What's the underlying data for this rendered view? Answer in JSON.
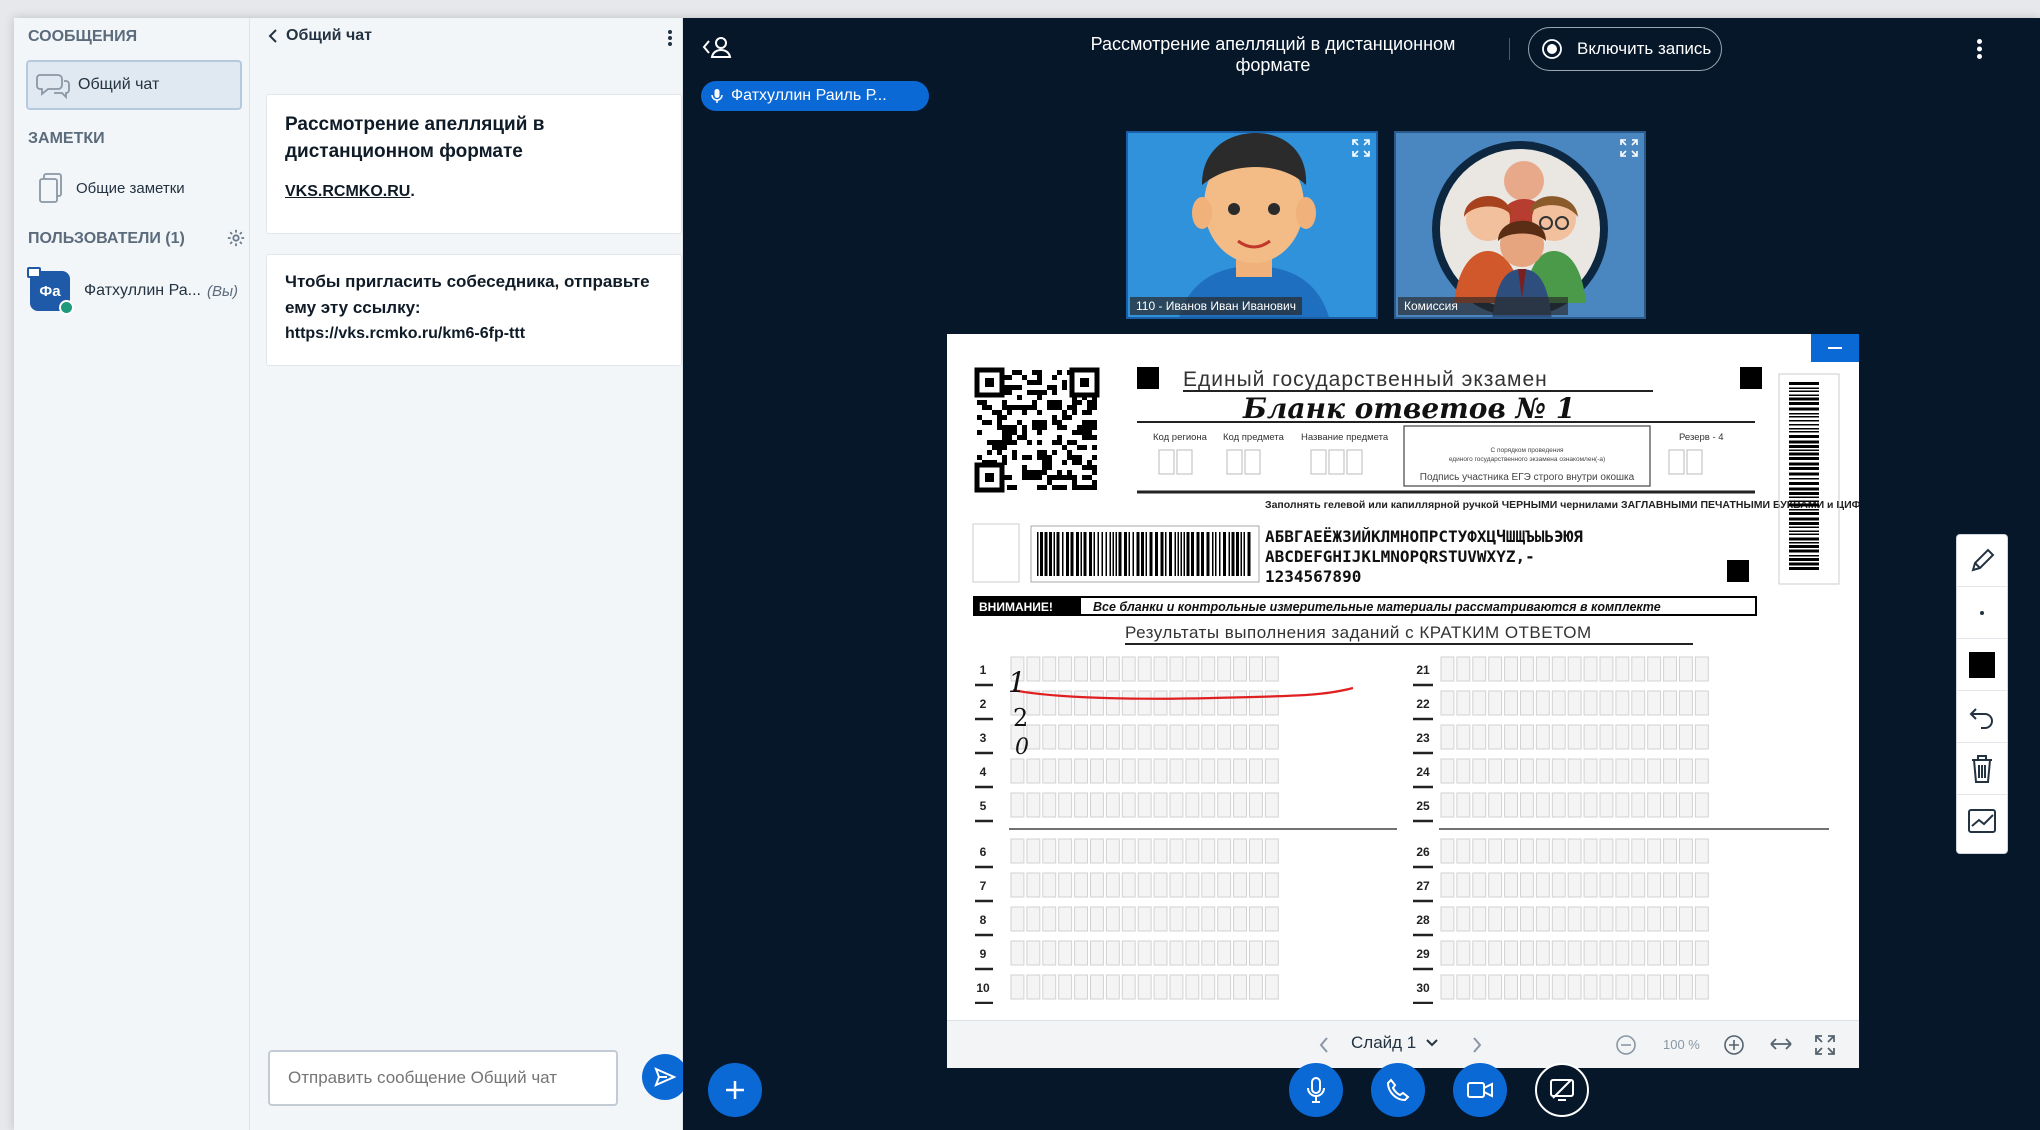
{
  "sidebar": {
    "messages_header": "СООБЩЕНИЯ",
    "public_chat_label": "Общий чат",
    "notes_header": "ЗАМЕТКИ",
    "shared_notes_label": "Общие заметки",
    "users_header": "ПОЛЬЗОВАТЕЛИ (1)",
    "user": {
      "avatar_initials": "Фа",
      "name": "Фатхуллин Ра...",
      "you_tag": "(Вы)",
      "avatar_color": "#1e5aa8"
    }
  },
  "chat": {
    "title": "Общий чат",
    "welcome_title": "Рассмотрение апелляций в дистанционном формате",
    "welcome_link": "VKS.RCMKO.RU",
    "invite_text": "Чтобы пригласить собеседника, отправьте ему эту ссылку:",
    "invite_url": "https://vks.rcmko.ru/km6-6fp-ttt",
    "input_placeholder": "Отправить сообщение Общий чат"
  },
  "header": {
    "meeting_title": "Рассмотрение апелляций в дистанционном формате",
    "record_label": "Включить запись"
  },
  "talking_indicator": "Фатхуллин Раиль Р...",
  "videos": [
    {
      "label": "110 - Иванов Иван Иванович",
      "icon": "student-avatar"
    },
    {
      "label": "Комиссия",
      "icon": "group-avatar"
    }
  ],
  "presentation": {
    "form_header": "Единый государственный экзамен",
    "form_title": "Бланк ответов № 1",
    "field_labels": [
      "Код региона",
      "Код предмета",
      "Название предмета"
    ],
    "signature_box_lines": [
      "С порядком проведения",
      "единого государственного экзамена ознакомлен(-а)",
      "Подпись участника ЕГЭ строго внутри окошка"
    ],
    "reserve_label": "Резерв - 4",
    "instruction_text": "Заполнять гелевой или капиллярной ручкой ЧЕРНЫМИ чернилами ЗАГЛАВНЫМИ ПЕЧАТНЫМИ БУКВАМИ и ЦИФРАМИ по следующим образцам:",
    "sample_row_1": "АБВГАЕЁЖЗИЙКЛМНОПРСТУФХЦЧШЩЪЫЬЭЮЯ",
    "sample_row_2": "ABCDEFGHIJKLMNOPQRSTUVWXYZ,-",
    "sample_row_3": "1234567890",
    "attention_label": "ВНИМАНИЕ!",
    "attention_text": "Все бланки и контрольные измерительные материалы рассматриваются в комплекте",
    "results_header": "Результаты выполнения заданий с КРАТКИМ ОТВЕТОМ",
    "row_numbers_left": [
      "1",
      "2",
      "3",
      "4",
      "5",
      "6",
      "7",
      "8",
      "9",
      "10"
    ],
    "row_numbers_right": [
      "21",
      "22",
      "23",
      "24",
      "25",
      "26",
      "27",
      "28",
      "29",
      "30"
    ],
    "handwritten_answers": [
      "1",
      "2",
      "0"
    ],
    "annotation_color": "#e02020",
    "slide_label": "Слайд 1",
    "zoom_label": "100 %"
  },
  "theme": {
    "main_bg": "#06172a",
    "accent": "#0b69d6",
    "sidebar_bg": "#f3f6f9"
  }
}
